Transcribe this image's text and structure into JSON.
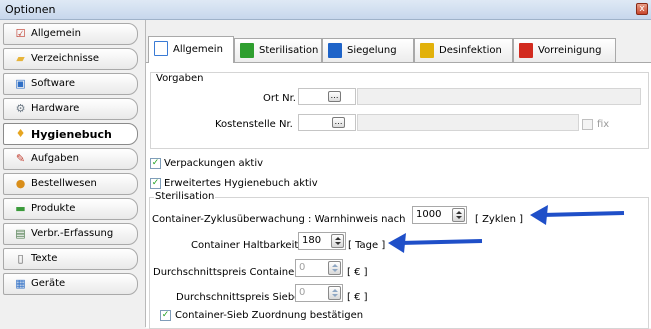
{
  "window": {
    "title": "Optionen",
    "close_glyph": "x"
  },
  "sidebar": {
    "items": [
      {
        "label": "Allgemein",
        "icon": "document-check-icon",
        "glyph": "☑",
        "color": "#c0392b",
        "active": false
      },
      {
        "label": "Verzeichnisse",
        "icon": "folder-icon",
        "glyph": "▰",
        "color": "#e7b43a",
        "active": false
      },
      {
        "label": "Software",
        "icon": "software-icon",
        "glyph": "▣",
        "color": "#2f6fc6",
        "active": false
      },
      {
        "label": "Hardware",
        "icon": "gear-icon",
        "glyph": "⚙",
        "color": "#6d7a86",
        "active": false
      },
      {
        "label": "Hygienebuch",
        "icon": "lightbulb-icon",
        "glyph": "♦",
        "color": "#e6a520",
        "active": true
      },
      {
        "label": "Aufgaben",
        "icon": "tasks-icon",
        "glyph": "✎",
        "color": "#c0392b",
        "active": false
      },
      {
        "label": "Bestellwesen",
        "icon": "order-icon",
        "glyph": "●",
        "color": "#d98e1a",
        "active": false
      },
      {
        "label": "Produkte",
        "icon": "products-icon",
        "glyph": "▬",
        "color": "#3a9a3a",
        "active": false
      },
      {
        "label": "Verbr.-Erfassung",
        "icon": "consumption-icon",
        "glyph": "▤",
        "color": "#4a7a4a",
        "active": false
      },
      {
        "label": "Texte",
        "icon": "text-icon",
        "glyph": "▯",
        "color": "#5a5a5a",
        "active": false
      },
      {
        "label": "Geräte",
        "icon": "devices-icon",
        "glyph": "▦",
        "color": "#2f6fc6",
        "active": false
      }
    ]
  },
  "tabs": [
    {
      "label": "Allgemein",
      "icon": "document-icon",
      "color": "#3a7bd5",
      "active": true
    },
    {
      "label": "Sterilisation",
      "icon": "green-book-icon",
      "color": "#2e9e2e",
      "active": false
    },
    {
      "label": "Siegelung",
      "icon": "blue-book-icon",
      "color": "#1e63c8",
      "active": false
    },
    {
      "label": "Desinfektion",
      "icon": "yellow-book-icon",
      "color": "#e2b10a",
      "active": false
    },
    {
      "label": "Vorreinigung",
      "icon": "red-book-icon",
      "color": "#d22b1f",
      "active": false
    }
  ],
  "vorgaben": {
    "title": "Vorgaben",
    "ort_label": "Ort Nr.",
    "ort_button": "…",
    "kostenstelle_label": "Kostenstelle Nr.",
    "kostenstelle_button": "…",
    "fix_label": "fix",
    "fix_checked": false
  },
  "checks": {
    "verpackungen_label": "Verpackungen aktiv",
    "verpackungen_checked": true,
    "erweitertes_label": "Erweitertes Hygienebuch aktiv",
    "erweitertes_checked": true,
    "checkmark": "✓"
  },
  "sterilisation": {
    "title": "Sterilisation",
    "zyklus_label": "Container-Zyklusüberwachung : Warnhinweis nach",
    "zyklus_value": "1000",
    "zyklus_unit": "[ Zyklen ]",
    "haltbarkeit_label": "Container Haltbarkeit",
    "haltbarkeit_value": "180",
    "haltbarkeit_unit": "[ Tage ]",
    "preis_container_label": "Durchschnittspreis Container",
    "preis_container_value": "0",
    "preis_container_unit": "[ € ]",
    "preis_siebe_label": "Durchschnittspreis Siebe",
    "preis_siebe_value": "0",
    "preis_siebe_unit": "[ € ]",
    "zuordnung_label": "Container-Sieb Zuordnung bestätigen",
    "zuordnung_checked": true
  },
  "colors": {
    "arrow": "#1f4fc8",
    "highlight_border": "#1f4fc8"
  }
}
